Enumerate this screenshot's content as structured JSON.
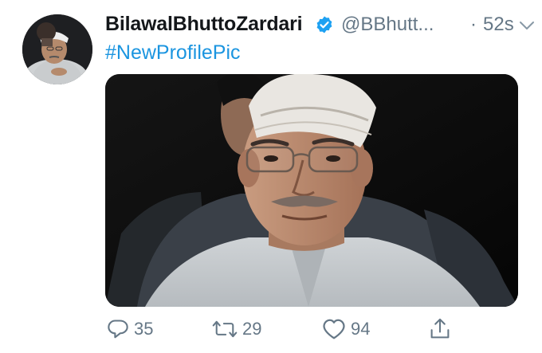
{
  "tweet": {
    "display_name": "BilawalBhuttoZardari",
    "handle": "@BBhutt...",
    "separator": "·",
    "timestamp": "52s",
    "text": "#NewProfilePic",
    "verified": true
  },
  "actions": {
    "reply_count": "35",
    "retweet_count": "29",
    "like_count": "94"
  },
  "icons": {
    "verified": "verified-badge-icon",
    "caret": "chevron-down-icon",
    "reply": "reply-icon",
    "retweet": "retweet-icon",
    "like": "heart-icon",
    "share": "share-icon"
  },
  "colors": {
    "link": "#1b95e0",
    "muted": "#657786",
    "verified": "#1da1f2",
    "text": "#14171a"
  }
}
